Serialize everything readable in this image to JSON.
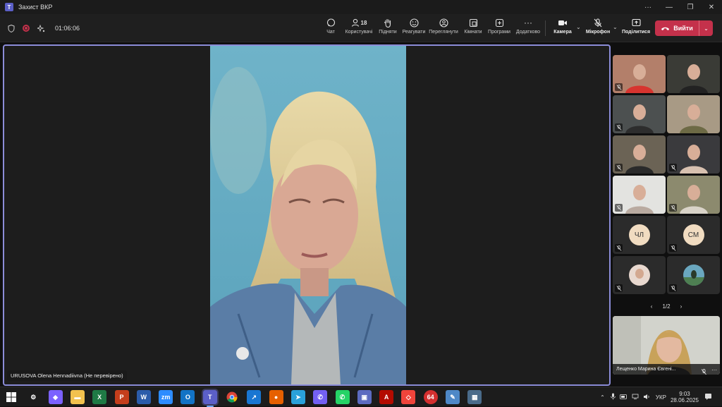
{
  "window": {
    "title": "Захист ВКР"
  },
  "meeting": {
    "elapsed": "01:06:06"
  },
  "toolbar": {
    "chat": "Чат",
    "people": "Користувачі",
    "people_count": "18",
    "raise": "Підняти",
    "react": "Реагувати",
    "view": "Переглянути",
    "rooms": "Кімнати",
    "apps": "Програми",
    "more": "Додатково",
    "camera": "Камера",
    "mic": "Мікрофон",
    "share": "Поділитися",
    "leave": "Вийти"
  },
  "stage": {
    "speaker_name": "URUSOVA Olena Hennadiivna (Не перевірено)"
  },
  "gallery": {
    "tiles": [
      {
        "initials": ""
      },
      {
        "initials": ""
      },
      {
        "initials": ""
      },
      {
        "initials": ""
      },
      {
        "initials": ""
      },
      {
        "initials": ""
      },
      {
        "initials": ""
      },
      {
        "initials": ""
      },
      {
        "initials": "ЧЛ"
      },
      {
        "initials": "СМ"
      },
      {
        "initials": ""
      },
      {
        "initials": ""
      }
    ],
    "page": "1/2"
  },
  "self_view": {
    "name": "Лещенко Марина Євгені..."
  },
  "taskbar": {
    "apps": [
      "start-icon",
      "settings-icon",
      "copilot-icon",
      "file-explorer-icon",
      "excel-icon",
      "powerpoint-icon",
      "word-icon",
      "zoom-icon",
      "outlook-icon",
      "teams-icon",
      "chrome-icon",
      "sync-icon",
      "firefox-icon",
      "telegram-icon",
      "viber-icon",
      "whatsapp-icon",
      "floppy-icon",
      "pdf-icon",
      "anydesk-icon",
      "64-icon",
      "paint-icon",
      "calculator-icon"
    ],
    "badge_64": "64",
    "lang": "УКР",
    "time": "9:03",
    "date": "28.06.2025"
  },
  "colors": {
    "accent": "#8b8cd8",
    "leave": "#c4314b",
    "teams": "#5b5fc7"
  }
}
